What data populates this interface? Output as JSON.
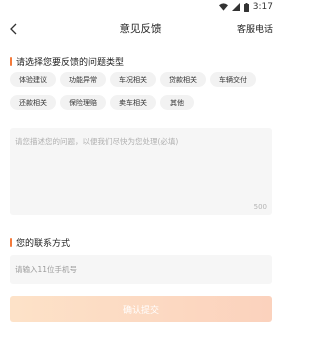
{
  "status_bar": {
    "time": "3:17"
  },
  "nav": {
    "title": "意见反馈",
    "right_link": "客服电话"
  },
  "problem_section": {
    "title": "请选择您要反馈的问题类型",
    "tags": [
      "体验建议",
      "功能异常",
      "车况相关",
      "贷款相关",
      "车辆交付",
      "还款相关",
      "保险理赔",
      "卖车相关",
      "其他"
    ]
  },
  "description": {
    "placeholder": "请您描述您的问题，以便我们尽快为您处理(必填)",
    "counter": "500"
  },
  "contact_section": {
    "title": "您的联系方式",
    "phone_placeholder": "请输入11位手机号"
  },
  "submit": {
    "label": "确认提交"
  },
  "colors": {
    "accent": "#f47a3b",
    "tag_bg": "#f2f2f2",
    "input_bg": "#f6f6f6",
    "button_start": "#fde2c8",
    "button_end": "#fbd2bd"
  }
}
